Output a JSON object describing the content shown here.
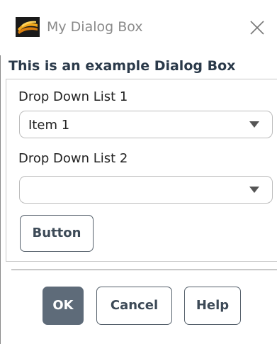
{
  "window": {
    "title": "My Dialog Box",
    "heading": "This is an example Dialog Box"
  },
  "group": {
    "dropdown1": {
      "label": "Drop Down List 1",
      "selected": "Item 1"
    },
    "dropdown2": {
      "label": "Drop Down List 2",
      "selected": ""
    },
    "button_label": "Button"
  },
  "footer": {
    "ok_label": "OK",
    "cancel_label": "Cancel",
    "help_label": "Help"
  },
  "colors": {
    "heading": "#2b3a4a",
    "ok_button_bg": "#5e6b79",
    "button_border": "#55606b",
    "title_gray": "#8a8a8a"
  },
  "icons": {
    "app": "app-logo-icon",
    "close": "close-icon",
    "dropdown": "chevron-down-icon"
  }
}
